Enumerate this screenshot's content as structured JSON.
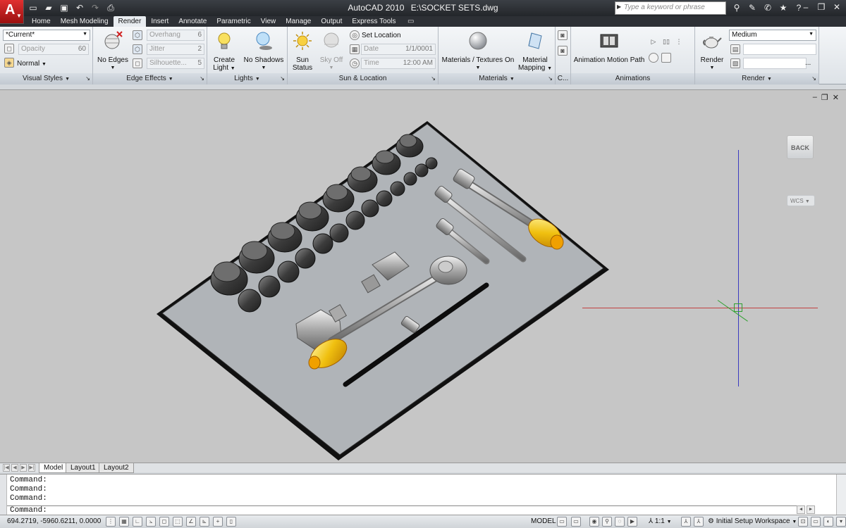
{
  "window": {
    "app_name": "AutoCAD 2010",
    "file_path": "E:\\SOCKET SETS.dwg",
    "search_placeholder": "Type a keyword or phrase"
  },
  "tabs": [
    {
      "label": "Home"
    },
    {
      "label": "Mesh Modeling"
    },
    {
      "label": "Render"
    },
    {
      "label": "Insert"
    },
    {
      "label": "Annotate"
    },
    {
      "label": "Parametric"
    },
    {
      "label": "View"
    },
    {
      "label": "Manage"
    },
    {
      "label": "Output"
    },
    {
      "label": "Express Tools"
    }
  ],
  "ribbon": {
    "visual_styles": {
      "title": "Visual Styles",
      "current_style": "*Current*",
      "opacity_label": "Opacity",
      "opacity_value": "60",
      "face_style": "Normal"
    },
    "edge_effects": {
      "title": "Edge Effects",
      "no_edges": "No Edges",
      "overhang_label": "Overhang",
      "overhang_value": "6",
      "jitter_label": "Jitter",
      "jitter_value": "2",
      "silhouette_label": "Silhouette...",
      "silhouette_value": "5"
    },
    "lights": {
      "title": "Lights",
      "create_light_1": "Create",
      "create_light_2": "Light",
      "no_shadows": "No Shadows"
    },
    "sun_location": {
      "title": "Sun & Location",
      "sun_status_1": "Sun",
      "sun_status_2": "Status",
      "sky_off": "Sky Off",
      "set_location": "Set Location",
      "date_label": "Date",
      "date_value": "1/1/0001",
      "time_label": "Time",
      "time_value": "12:00 AM"
    },
    "materials": {
      "title": "Materials",
      "materials_textures": "Materials / Textures On",
      "material_mapping_1": "Material",
      "material_mapping_2": "Mapping"
    },
    "camera": {
      "title": "C..."
    },
    "animations": {
      "title": "Animations",
      "motion_path": "Animation Motion Path"
    },
    "render": {
      "title": "Render",
      "render_button": "Render",
      "quality": "Medium",
      "more": "..."
    }
  },
  "viewport": {
    "viewcube_label": "BACK",
    "wcs_label": "WCS"
  },
  "layout_tabs": [
    {
      "label": "Model"
    },
    {
      "label": "Layout1"
    },
    {
      "label": "Layout2"
    }
  ],
  "command": {
    "lines": [
      "Command:",
      "Command:",
      "Command:"
    ],
    "prompt": "Command:"
  },
  "status": {
    "coordinates": "694.2719, -5960.6211, 0.0000",
    "model": "MODEL",
    "scale": "1:1",
    "workspace": "Initial Setup Workspace"
  },
  "colors": {
    "title_bar": "#2a2d31",
    "ribbon": "#e8ecf0",
    "viewport_bg": "#c6c6c6",
    "tray": "#b0b4b8",
    "socket": "#4a4a4a",
    "handle_grip": "#f0c020",
    "ucs_x": "#c04040",
    "ucs_y": "#30a030",
    "ucs_z": "#3a3ac0"
  }
}
